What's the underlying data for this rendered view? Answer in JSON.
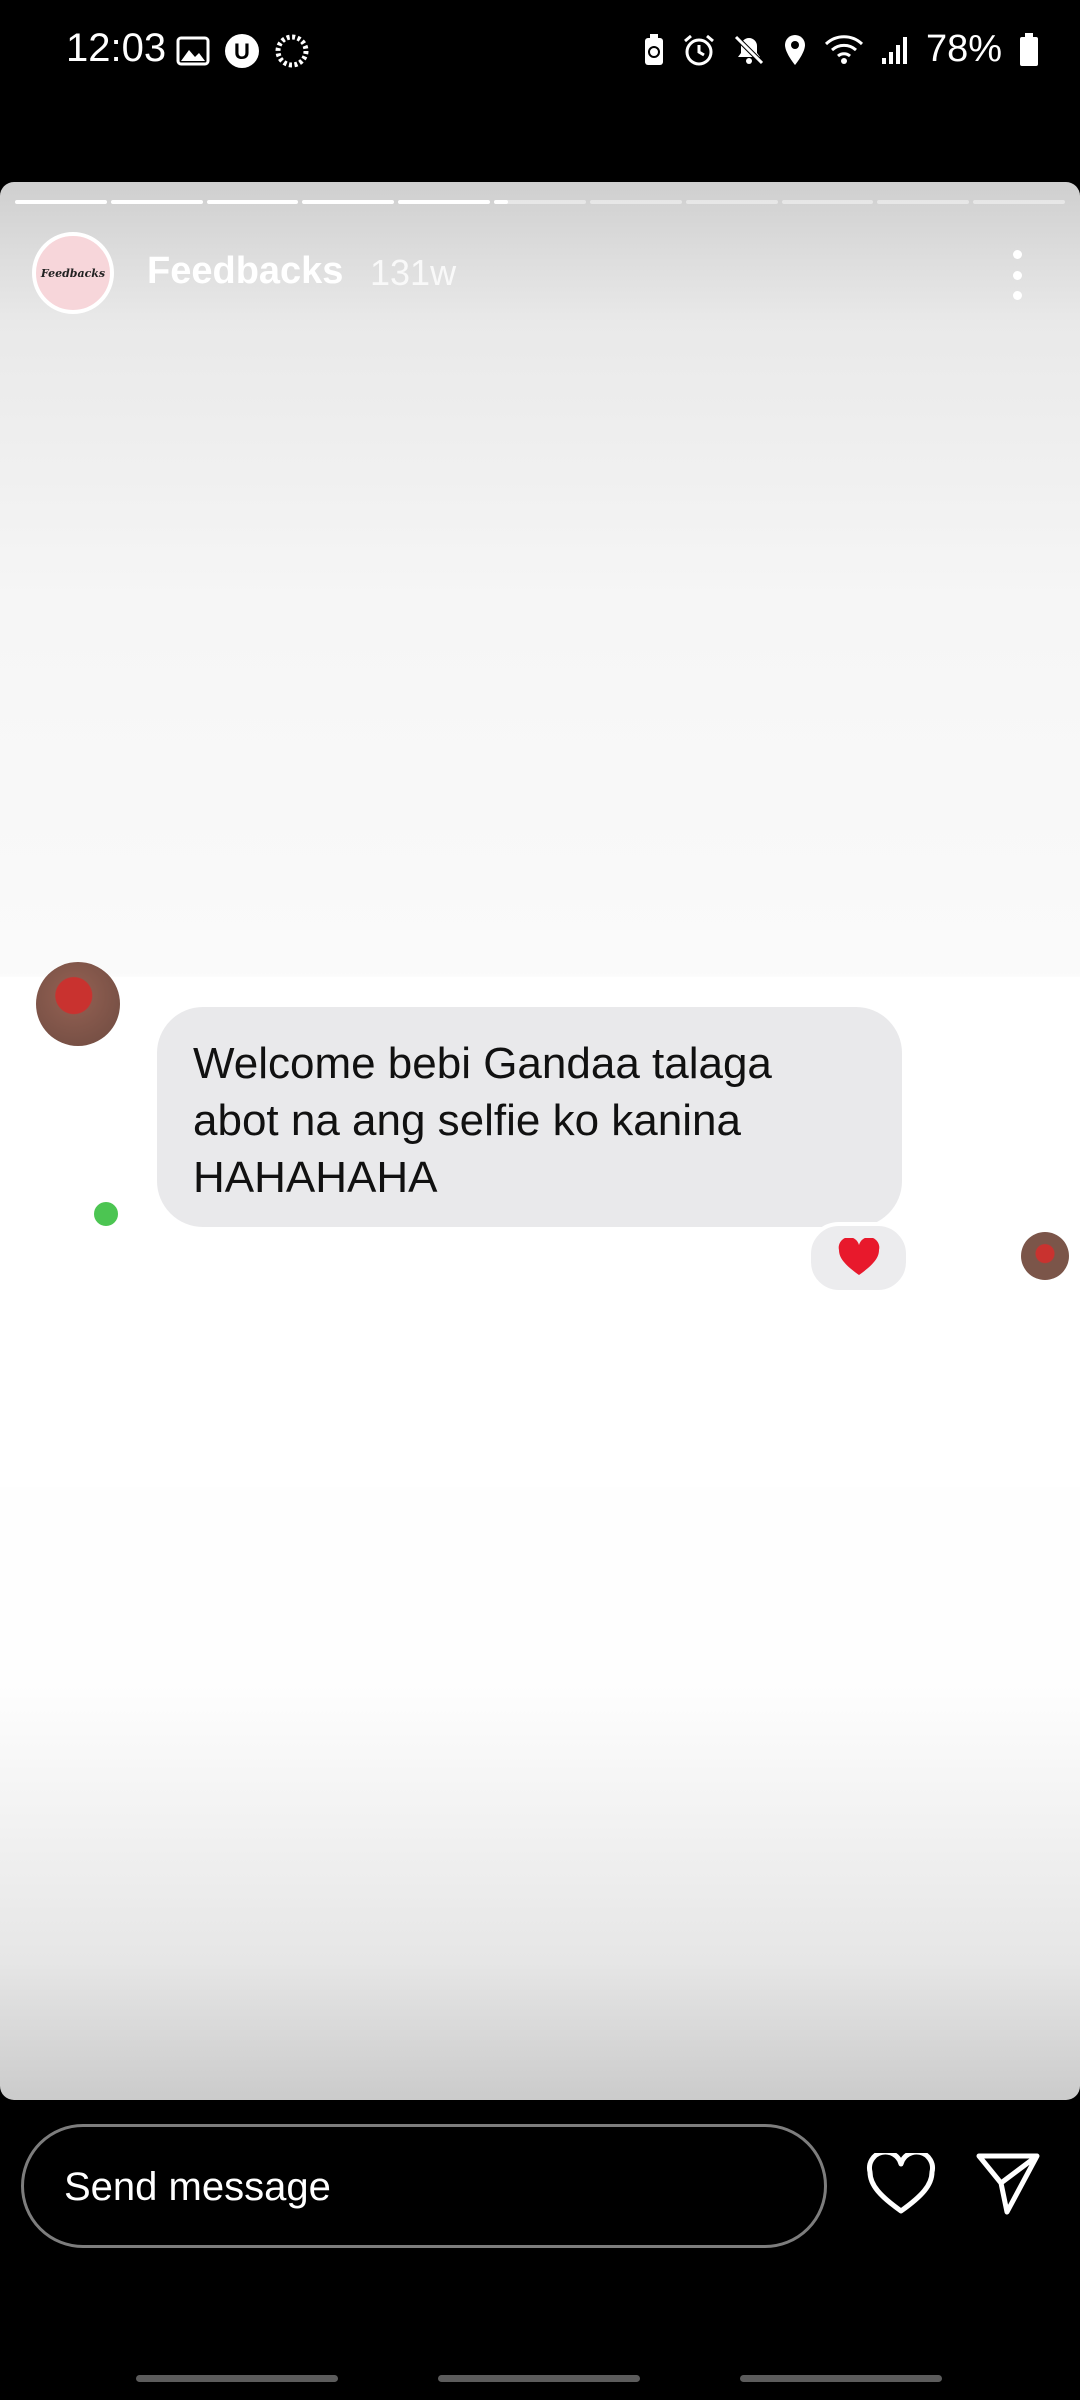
{
  "status_bar": {
    "time": "12:03",
    "battery": "78%",
    "left_icons": [
      "image-icon",
      "u-badge-icon",
      "sync-icon"
    ],
    "right_icons": [
      "battery-saver-icon",
      "alarm-icon",
      "mute-icon",
      "location-icon",
      "wifi-icon",
      "signal-icon",
      "battery-icon"
    ]
  },
  "story": {
    "username": "Feedbacks",
    "time_ago": "131w",
    "avatar_text": "Feedbacks",
    "progress": {
      "total_segments": 11,
      "completed_segments": 5,
      "current_segment_fraction": 0.15
    }
  },
  "chat": {
    "message_lines": [
      "Welcome bebi Gandaa talaga",
      "abot na ang selfie ko kanina",
      "HAHAHAHA"
    ],
    "reaction": "❤️"
  },
  "composer": {
    "placeholder": "Send message"
  },
  "colors": {
    "bubble": "#e9e9eb",
    "online": "#4cc552",
    "heart": "#e8192c"
  }
}
